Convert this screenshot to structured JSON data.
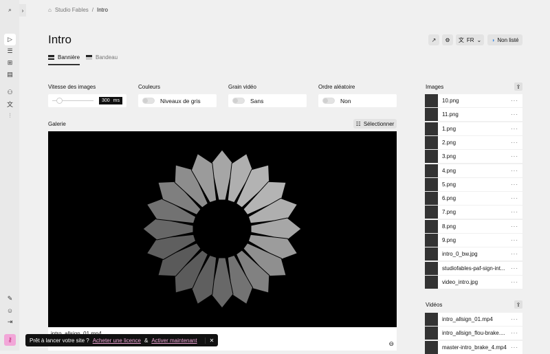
{
  "breadcrumb": {
    "home": "Studio Fables",
    "current": "Intro"
  },
  "page_title": "Intro",
  "tabs": [
    {
      "label": "Bannière",
      "active": true
    },
    {
      "label": "Bandeau",
      "active": false
    }
  ],
  "header": {
    "language": "FR",
    "visibility": "Non listé"
  },
  "settings": {
    "speed": {
      "label": "Vitesse des images",
      "value": "300",
      "unit": "ms"
    },
    "colors": {
      "label": "Couleurs",
      "value": "Niveaux de gris"
    },
    "grain": {
      "label": "Grain vidéo",
      "value": "Sans"
    },
    "random": {
      "label": "Ordre aléatoire",
      "value": "Non"
    }
  },
  "gallery": {
    "label": "Galerie",
    "select_label": "Sélectionner",
    "caption": "intro_allsign_01.mp4"
  },
  "images": {
    "title": "Images",
    "items": [
      "10.png",
      "11.png",
      "1.png",
      "2.png",
      "3.png",
      "4.png",
      "5.png",
      "6.png",
      "7.png",
      "8.png",
      "9.png",
      "intro_0_bw.jpg",
      "studiofables-paf-sign-int...",
      "video_intro.jpg"
    ]
  },
  "videos": {
    "title": "Vidéos",
    "items": [
      "intro_allsign_01.mp4",
      "intro_allsign_flou-brake....",
      "master-intro_brake_4.mp4"
    ]
  },
  "toast": {
    "text": "Prêt à lancer votre site ?",
    "link1": "Acheter une licence",
    "sep": "&",
    "link2": "Activer maintenant"
  },
  "colors": {
    "accent": "#f2a6d8"
  }
}
